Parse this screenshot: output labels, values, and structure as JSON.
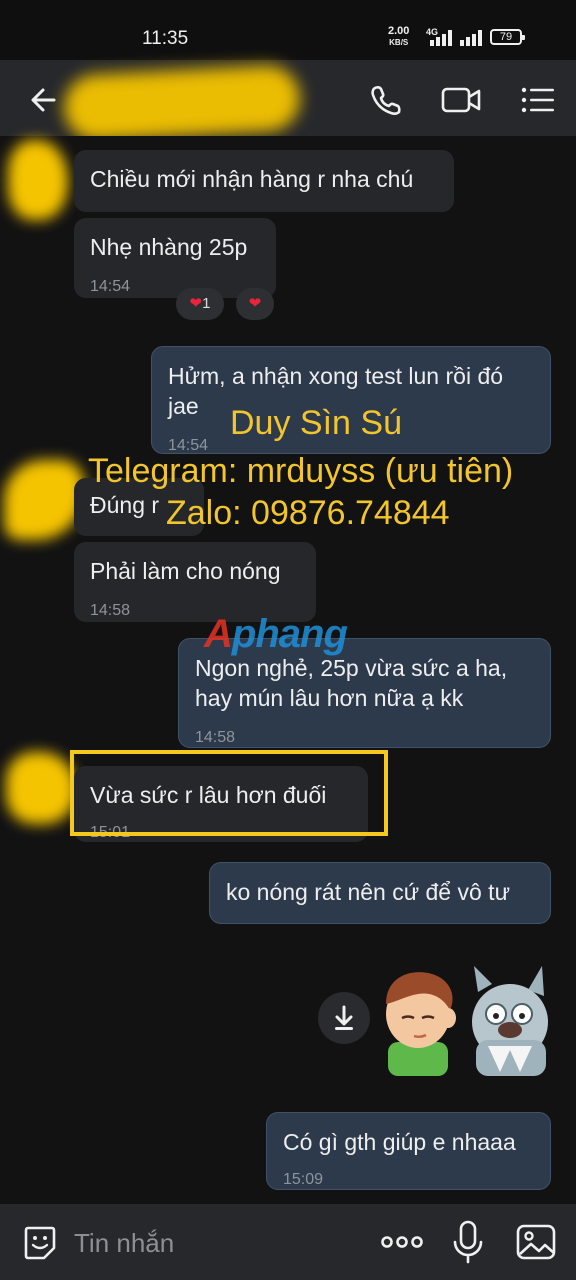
{
  "status": {
    "time": "11:35",
    "speed_value": "2.00",
    "speed_unit": "KB/S",
    "network": "4G",
    "battery": "79"
  },
  "header": {
    "back_icon": "back-arrow-icon",
    "call_icon": "phone-icon",
    "video_icon": "video-camera-icon",
    "menu_icon": "list-menu-icon"
  },
  "messages": [
    {
      "dir": "in",
      "text": "Chiều mới nhận hàng r nha chú",
      "time": ""
    },
    {
      "dir": "in",
      "text": "Nhẹ nhàng 25p",
      "time": "14:54"
    },
    {
      "dir": "out",
      "text": "Hửm, a nhận xong test lun rồi đó jae",
      "time": "14:54"
    },
    {
      "dir": "in",
      "text": "Đúng r",
      "time": ""
    },
    {
      "dir": "in",
      "text": "Phải làm cho nóng",
      "time": "14:58"
    },
    {
      "dir": "out",
      "text": "Ngon nghẻ, 25p vừa sức a ha, hay mún lâu hơn nữa ạ kk",
      "time": "14:58"
    },
    {
      "dir": "in",
      "text": "Vừa sức r lâu hơn đuối",
      "time": "15:01"
    },
    {
      "dir": "out",
      "text": "ko nóng rát nên cứ để vô tư",
      "time": ""
    },
    {
      "dir": "out",
      "text": "Có gì gth giúp e nhaaa",
      "time": "15:09"
    }
  ],
  "reactions": {
    "heart_count": "1"
  },
  "watermark": {
    "line1": "Duy Sìn Sú",
    "line2": "Telegram: mrduyss (ưu tiên)",
    "line3": "Zalo: 09876.74844",
    "logo_a": "A",
    "logo_rest": "phang"
  },
  "input": {
    "placeholder": "Tin nhắn"
  },
  "colors": {
    "accent_yellow": "#f2c52b",
    "outgoing_bubble": "#2d3a4c",
    "incoming_bubble": "#26272a"
  }
}
